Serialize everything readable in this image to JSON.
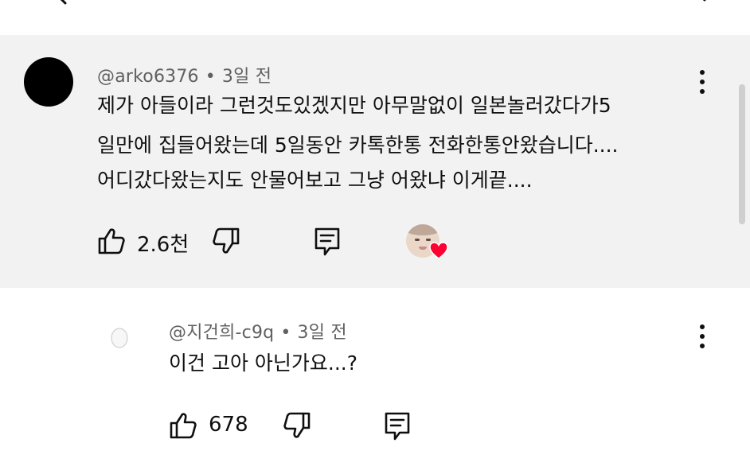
{
  "comments": [
    {
      "author": "@arko6376",
      "time": "3일 전",
      "lines": [
        "제가 아들이라 그런것도있겠지만 아무말없이 일본놀러갔다가5",
        "일만에 집들어왔는데 5일동안 카톡한통 전화한통안왔습니다....",
        "어디갔다왔는지도 안물어보고 그냥 어왔냐 이게끝...."
      ],
      "likes": "2.6천",
      "avatar_color": "#000000",
      "highlighted": true,
      "creator_heart": true
    },
    {
      "author": "@지건희-c9q",
      "time": "3일 전",
      "lines": [
        "이건 고아 아닌가요...?"
      ],
      "likes": "678",
      "highlighted": false,
      "creator_heart": false
    }
  ],
  "separator": "•",
  "colors": {
    "highlight_bg": "#f2f2f2",
    "meta_text": "#606060",
    "heart": "#ff0033"
  },
  "icons": [
    "back-arrow-icon",
    "kebab-menu-icon",
    "thumbs-up-icon",
    "thumbs-down-icon",
    "reply-icon",
    "creator-heart-icon"
  ]
}
